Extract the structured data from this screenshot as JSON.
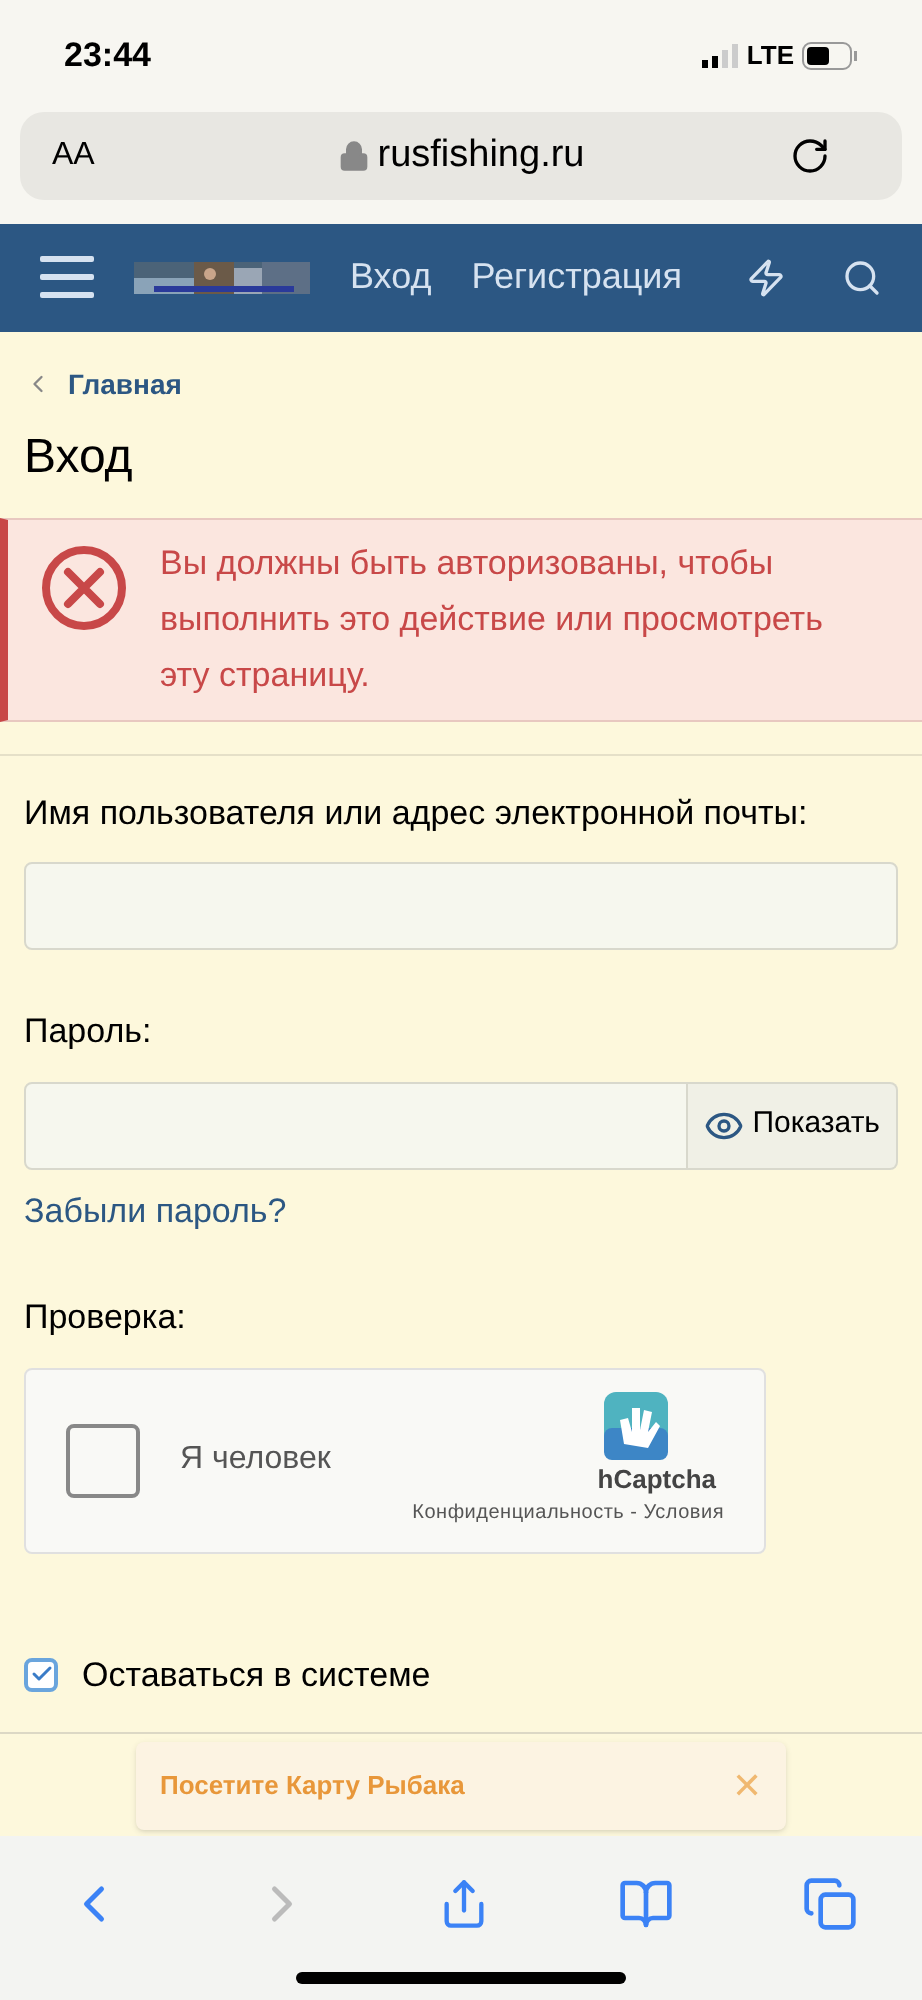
{
  "status_bar": {
    "time": "23:44",
    "network": "LTE"
  },
  "address_bar": {
    "text_size": "AA",
    "url": "rusfishing.ru"
  },
  "nav": {
    "items": [
      {
        "label": "Вход"
      },
      {
        "label": "Регистрация"
      }
    ]
  },
  "breadcrumb": "Главная",
  "title": "Вход",
  "error": "Вы должны быть авторизованы, чтобы выполнить это действие или просмотреть эту страницу.",
  "form": {
    "username_label": "Имя пользователя или адрес электронной почты:",
    "password_label": "Пароль:",
    "show_password": "Показать",
    "forgot": "Забыли пароль?",
    "verify_label": "Проверка:",
    "captcha": {
      "checked": false,
      "label": "Я человек",
      "brand": "hCaptcha",
      "links": "Конфиденциальность - Условия"
    },
    "remember": {
      "checked": true,
      "label": "Оставаться в системе"
    }
  },
  "banner": {
    "text": "Посетите Карту Рыбака",
    "close": "✕"
  },
  "toolbar": {
    "forward_disabled": true
  }
}
